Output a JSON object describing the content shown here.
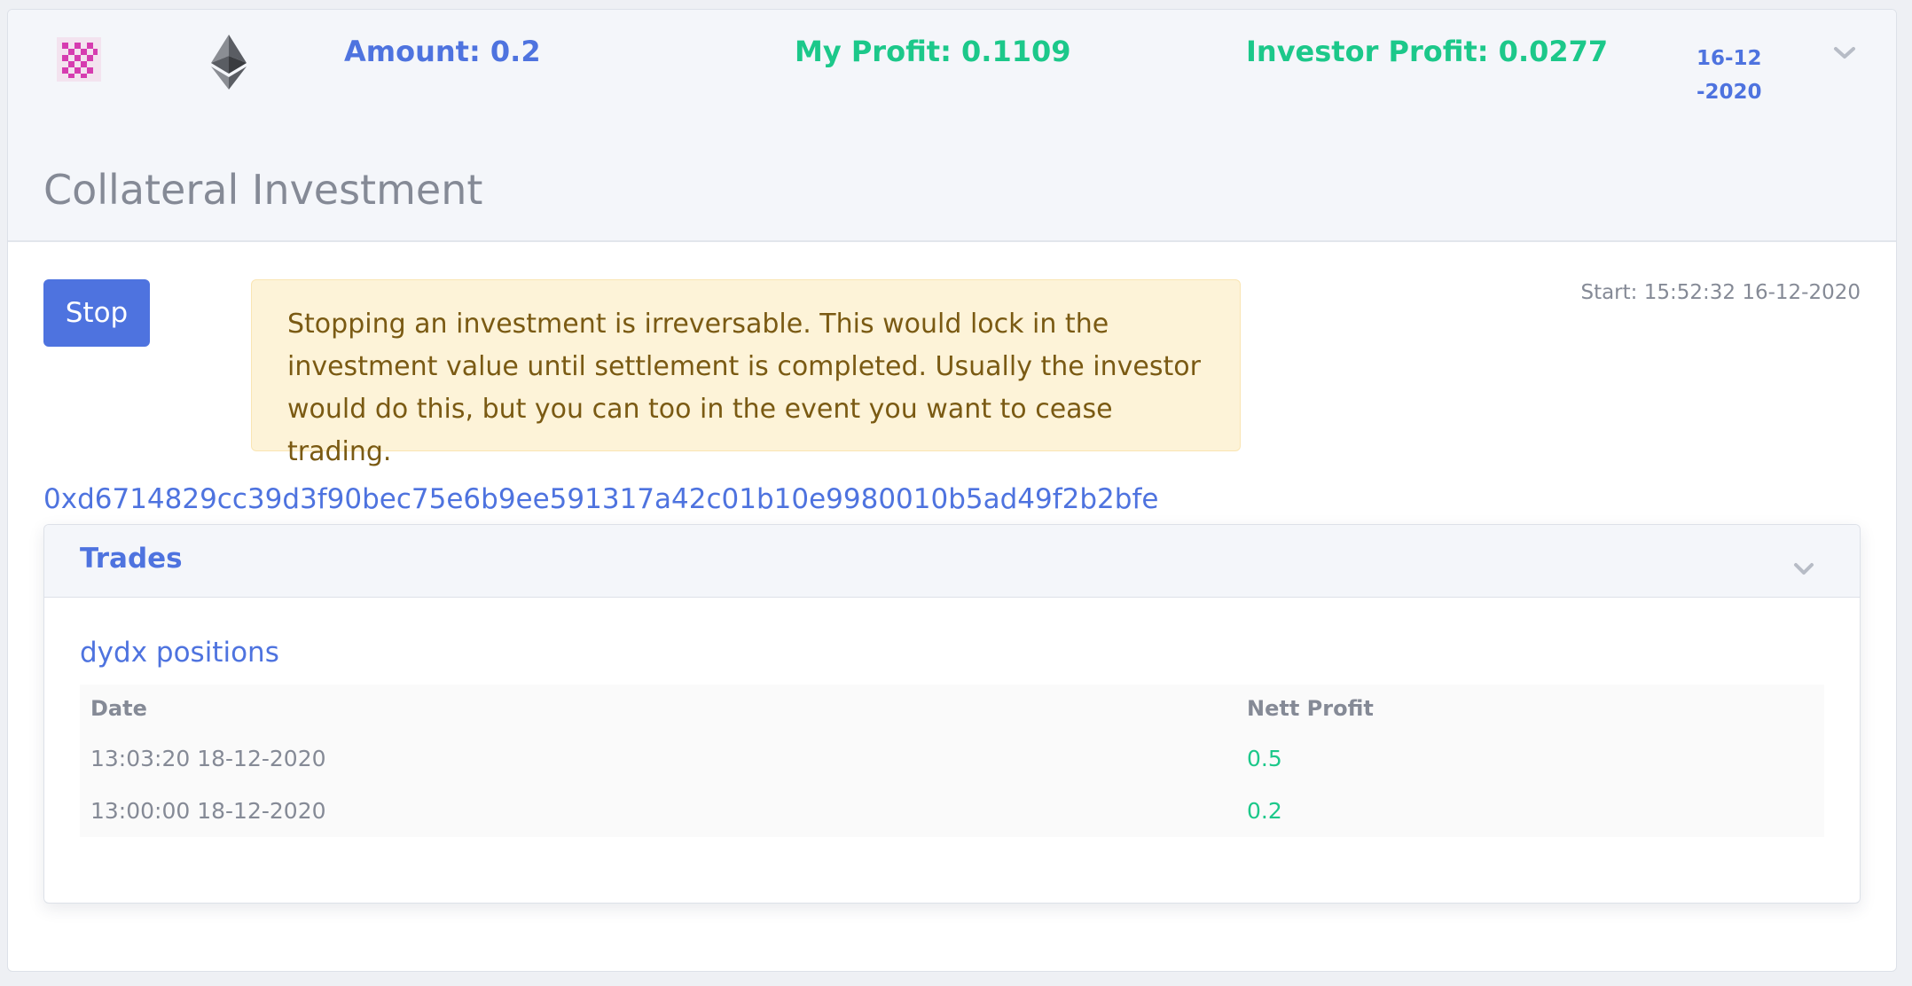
{
  "summary": {
    "token_icon": "pink-checker-token-icon",
    "eth_icon": "ethereum-icon",
    "amount": "Amount: 0.2",
    "my_profit": "My Profit: 0.1109",
    "investor_profit": "Investor Profit: 0.0277",
    "date": "16-12-2020",
    "expand_icon": "chevron-down-icon"
  },
  "section": {
    "title": "Collateral Investment"
  },
  "actions": {
    "stop_label": "Stop"
  },
  "alert": {
    "text": "Stopping an investment is irreversable. This would lock in the investment value until settlement is completed. Usually the investor would do this, but you can too in the event you want to cease trading."
  },
  "start_time": "Start: 15:52:32 16-12-2020",
  "tx_hash": "0xd6714829cc39d3f90bec75e6b9ee591317a42c01b10e9980010b5ad49f2b2bfe",
  "trades": {
    "title": "Trades",
    "subheading": "dydx positions",
    "columns": [
      "Date",
      "Nett Profit"
    ],
    "rows": [
      {
        "date": "13:03:20 18-12-2020",
        "profit": "0.5"
      },
      {
        "date": "13:00:00 18-12-2020",
        "profit": "0.2"
      }
    ]
  },
  "colors": {
    "primary": "#4e73df",
    "success": "#1cc88a",
    "alert_bg": "#fdf3d8",
    "alert_text": "#7a5a13"
  }
}
